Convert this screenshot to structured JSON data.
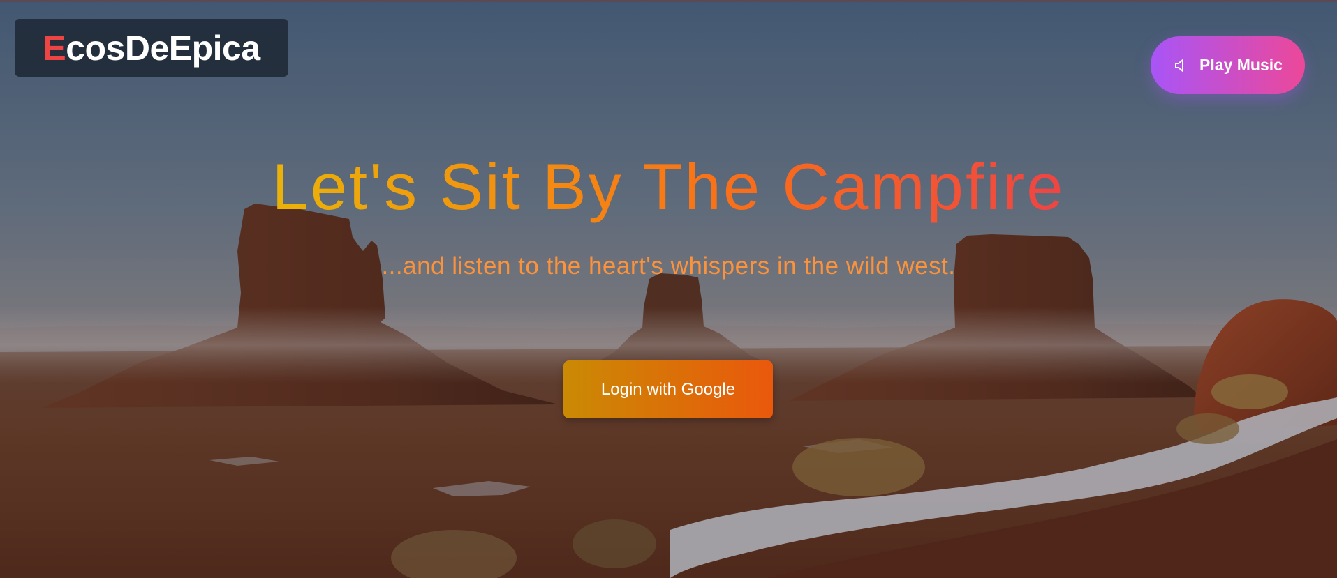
{
  "header": {
    "logo_first_letter": "E",
    "logo_rest": "cosDeEpica",
    "music_button_label": "Play Music",
    "music_button_icon": "speaker-icon"
  },
  "hero": {
    "title": "Let's Sit By The Campfire",
    "subtitle": "...and listen to the heart's whispers in the wild west.",
    "login_button_label": "Login with Google"
  },
  "colors": {
    "logo_accent": "#ef4444",
    "music_gradient": [
      "#a855f7",
      "#ec4899"
    ],
    "title_gradient": [
      "#eab308",
      "#f97316",
      "#ef4444"
    ],
    "subtitle": "#fb923c",
    "login_gradient": [
      "#ca8a04",
      "#ea580c"
    ]
  },
  "background": {
    "scene": "desert-mesas-photo"
  }
}
